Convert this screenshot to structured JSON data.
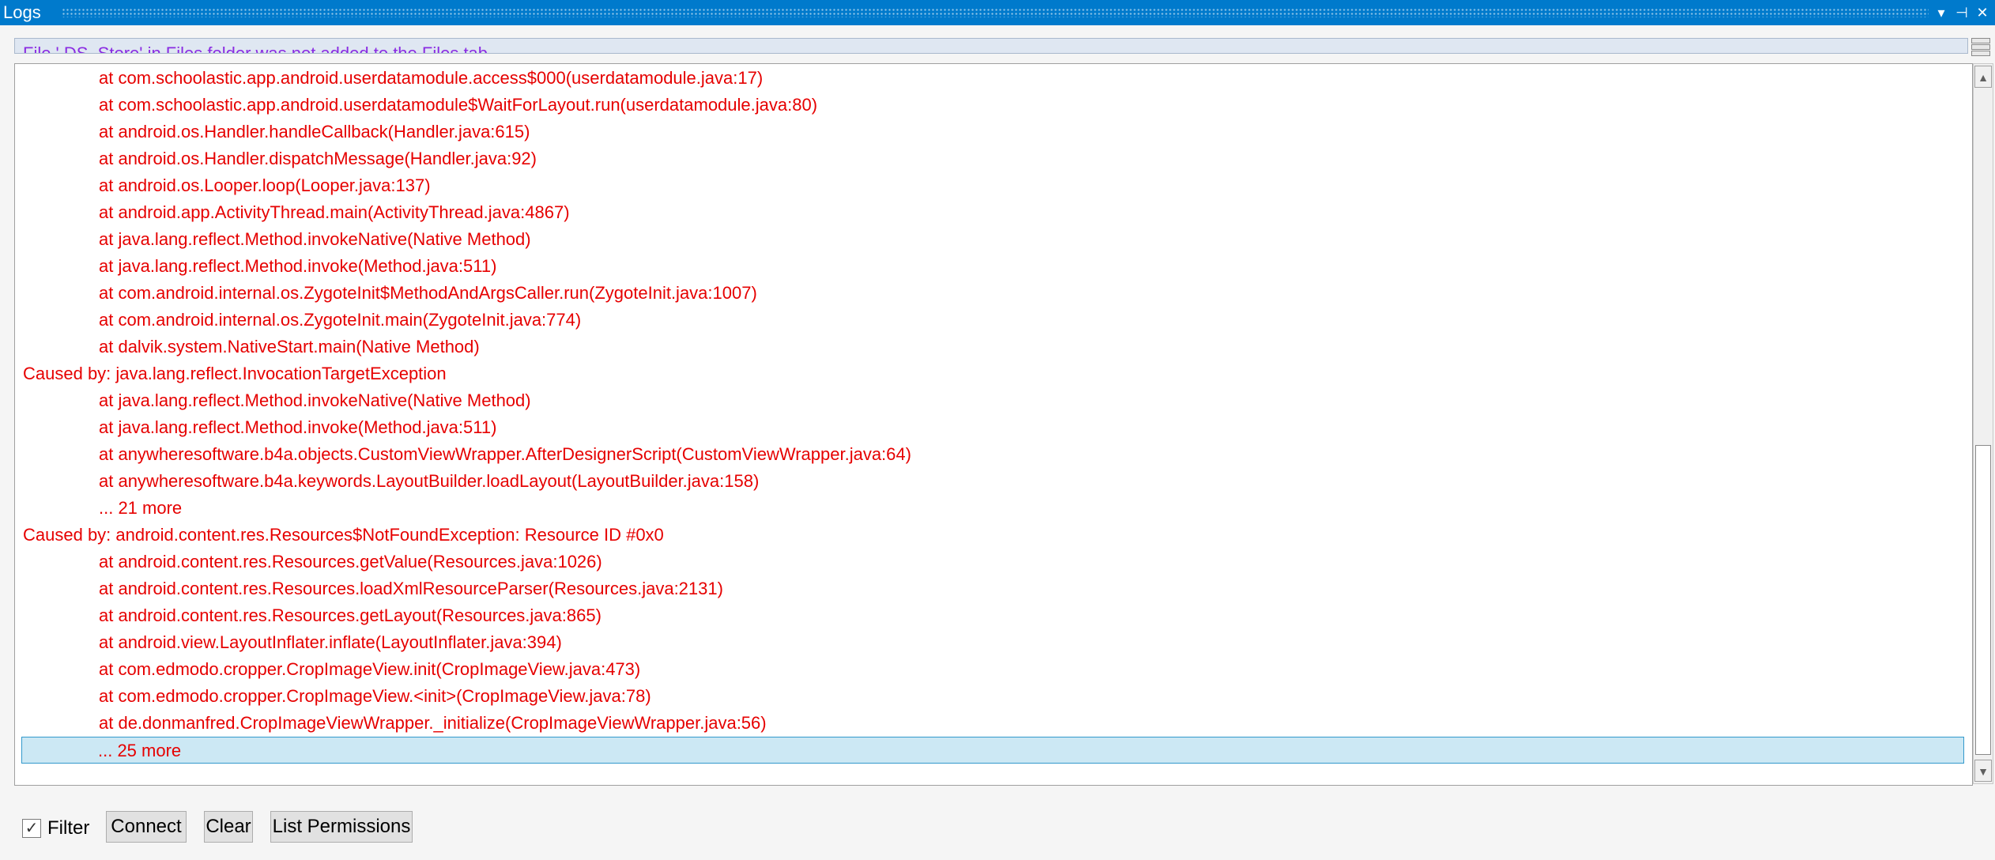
{
  "window": {
    "title": "Logs",
    "controls": {
      "dropdown": "▾",
      "pin": "⊣",
      "close": "✕"
    }
  },
  "message_strip": {
    "text": "File '.DS_Store' in Files folder was not added to the Files tab."
  },
  "log": {
    "lines": [
      {
        "text": "at com.schoolastic.app.android.userdatamodule.access$000(userdatamodule.java:17)",
        "indent": true
      },
      {
        "text": "at com.schoolastic.app.android.userdatamodule$WaitForLayout.run(userdatamodule.java:80)",
        "indent": true
      },
      {
        "text": "at android.os.Handler.handleCallback(Handler.java:615)",
        "indent": true
      },
      {
        "text": "at android.os.Handler.dispatchMessage(Handler.java:92)",
        "indent": true
      },
      {
        "text": "at android.os.Looper.loop(Looper.java:137)",
        "indent": true
      },
      {
        "text": "at android.app.ActivityThread.main(ActivityThread.java:4867)",
        "indent": true
      },
      {
        "text": "at java.lang.reflect.Method.invokeNative(Native Method)",
        "indent": true
      },
      {
        "text": "at java.lang.reflect.Method.invoke(Method.java:511)",
        "indent": true
      },
      {
        "text": "at com.android.internal.os.ZygoteInit$MethodAndArgsCaller.run(ZygoteInit.java:1007)",
        "indent": true
      },
      {
        "text": "at com.android.internal.os.ZygoteInit.main(ZygoteInit.java:774)",
        "indent": true
      },
      {
        "text": "at dalvik.system.NativeStart.main(Native Method)",
        "indent": true
      },
      {
        "text": "Caused by: java.lang.reflect.InvocationTargetException",
        "indent": false
      },
      {
        "text": "at java.lang.reflect.Method.invokeNative(Native Method)",
        "indent": true
      },
      {
        "text": "at java.lang.reflect.Method.invoke(Method.java:511)",
        "indent": true
      },
      {
        "text": "at anywheresoftware.b4a.objects.CustomViewWrapper.AfterDesignerScript(CustomViewWrapper.java:64)",
        "indent": true
      },
      {
        "text": "at anywheresoftware.b4a.keywords.LayoutBuilder.loadLayout(LayoutBuilder.java:158)",
        "indent": true
      },
      {
        "text": "... 21 more",
        "indent": true
      },
      {
        "text": "Caused by: android.content.res.Resources$NotFoundException: Resource ID #0x0",
        "indent": false
      },
      {
        "text": "at android.content.res.Resources.getValue(Resources.java:1026)",
        "indent": true
      },
      {
        "text": "at android.content.res.Resources.loadXmlResourceParser(Resources.java:2131)",
        "indent": true
      },
      {
        "text": "at android.content.res.Resources.getLayout(Resources.java:865)",
        "indent": true
      },
      {
        "text": "at android.view.LayoutInflater.inflate(LayoutInflater.java:394)",
        "indent": true
      },
      {
        "text": "at com.edmodo.cropper.CropImageView.init(CropImageView.java:473)",
        "indent": true
      },
      {
        "text": "at com.edmodo.cropper.CropImageView.<init>(CropImageView.java:78)",
        "indent": true
      },
      {
        "text": "at de.donmanfred.CropImageViewWrapper._initialize(CropImageViewWrapper.java:56)",
        "indent": true
      },
      {
        "text": "... 25 more",
        "indent": true,
        "selected": true
      }
    ],
    "scroll": {
      "up": "▲",
      "down": "▼"
    }
  },
  "toolbar": {
    "filter_label": "Filter",
    "filter_checked": true,
    "filter_check_glyph": "✓",
    "connect_label": "Connect",
    "clear_label": "Clear",
    "permissions_label": "List Permissions"
  },
  "colors": {
    "title_bar": "#007acc",
    "log_text": "#e60000",
    "message_text": "#8a2be2",
    "selection": "#cce8f4"
  }
}
